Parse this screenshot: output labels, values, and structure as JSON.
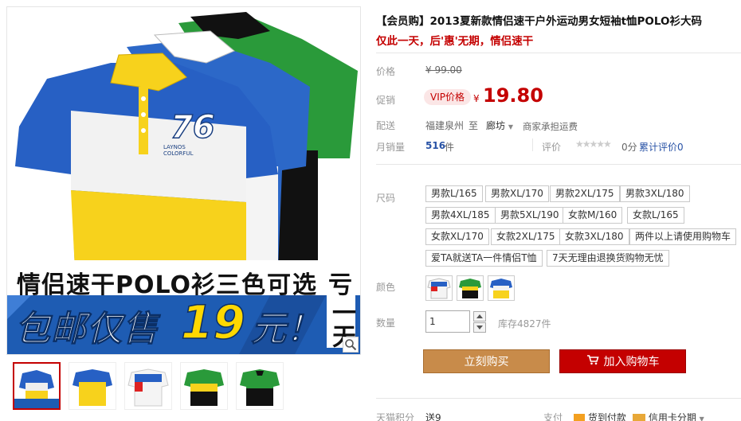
{
  "product": {
    "title": "【会员购】2013夏新款情侣速干户外运动男女短袖t恤POLO衫大码",
    "subtitle": "仅此一天，后'惠'无期，情侣速干"
  },
  "image": {
    "banner_line1_left": "情侣速干POLO衫",
    "banner_line1_right": "三色可选",
    "banner_big_left": "包邮仅售",
    "banner_price": "19",
    "banner_unit": "元！",
    "side_char_top": "亏",
    "side_chars_bottom": "一天",
    "shirt_number": "76",
    "shirt_brand_line1": "LAYNOS",
    "shirt_brand_line2": "COLORFUL"
  },
  "price": {
    "label": "价格",
    "original": "¥ 99.00",
    "promo_label": "促销",
    "vip_tag": "VIP价格",
    "currency": "¥",
    "current": "19.80"
  },
  "shipping": {
    "label": "配送",
    "origin": "福建泉州",
    "to": "至",
    "destination": "廊坊",
    "note": "商家承担运费"
  },
  "sales": {
    "label": "月销量",
    "count": "516",
    "unit": "件",
    "rating_label": "评价",
    "rating_score": "0分",
    "total_rating": "累计评价",
    "total_rating_count": "0"
  },
  "sizes": {
    "label": "尺码",
    "options": [
      "男款L/165",
      "男款XL/170",
      "男款2XL/175",
      "男款3XL/180",
      "男款4XL/185",
      "男款5XL/190",
      "女款M/160",
      "女款L/165",
      "女款XL/170",
      "女款2XL/175",
      "女款3XL/180",
      "两件以上请使用购物车",
      "爱TA就送TA一件情侣T恤",
      "7天无理由退换货购物无忧"
    ]
  },
  "color": {
    "label": "颜色"
  },
  "quantity": {
    "label": "数量",
    "value": "1",
    "stock": "库存4827件"
  },
  "actions": {
    "buy_now": "立刻购买",
    "add_to_cart": "加入购物车"
  },
  "footer": {
    "points_label": "天猫积分",
    "points_value": "送9",
    "pay_label": "支付",
    "pay_cod": "货到付款",
    "pay_credit": "信用卡分期"
  },
  "colors": {
    "accent": "#c40000",
    "buy_button": "#c88b4a",
    "banner_blue": "#1e5cb3",
    "banner_yellow": "#ffd800"
  }
}
